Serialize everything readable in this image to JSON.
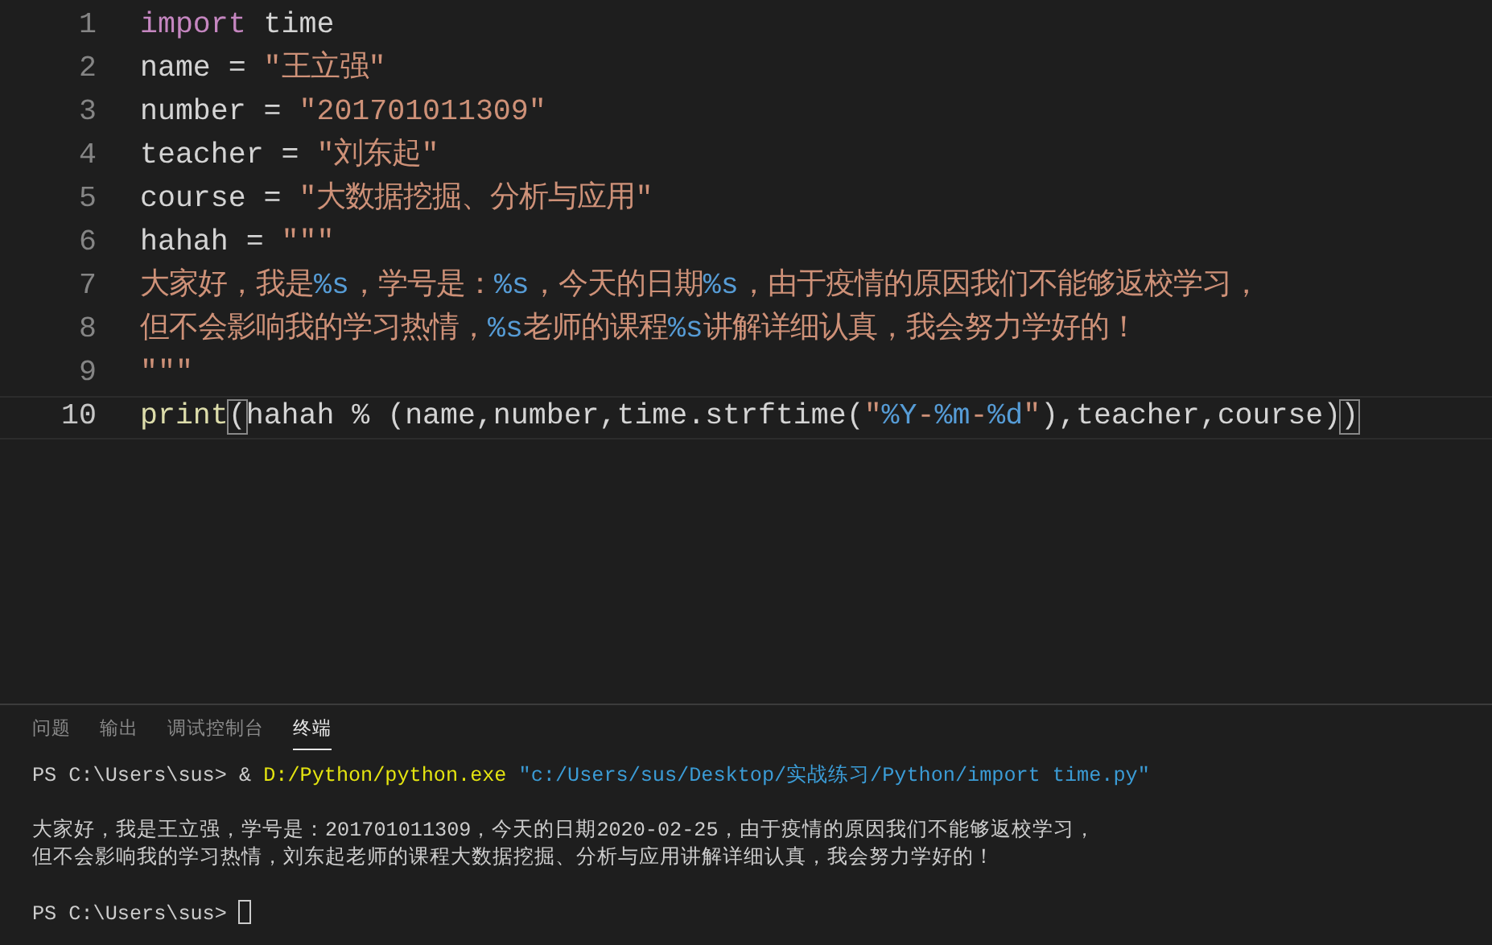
{
  "editor": {
    "lines": [
      {
        "number": "1",
        "current": false,
        "tokens": [
          {
            "kind": "keyword",
            "text": "import"
          },
          {
            "kind": "plain",
            "text": " time"
          }
        ]
      },
      {
        "number": "2",
        "current": false,
        "tokens": [
          {
            "kind": "plain",
            "text": "name = "
          },
          {
            "kind": "string",
            "text": "\"王立强\""
          }
        ]
      },
      {
        "number": "3",
        "current": false,
        "tokens": [
          {
            "kind": "plain",
            "text": "number = "
          },
          {
            "kind": "string",
            "text": "\"201701011309\""
          }
        ]
      },
      {
        "number": "4",
        "current": false,
        "tokens": [
          {
            "kind": "plain",
            "text": "teacher = "
          },
          {
            "kind": "string",
            "text": "\"刘东起\""
          }
        ]
      },
      {
        "number": "5",
        "current": false,
        "tokens": [
          {
            "kind": "plain",
            "text": "course = "
          },
          {
            "kind": "string",
            "text": "\"大数据挖掘、分析与应用\""
          }
        ]
      },
      {
        "number": "6",
        "current": false,
        "tokens": [
          {
            "kind": "plain",
            "text": "hahah = "
          },
          {
            "kind": "string",
            "text": "\"\"\""
          }
        ]
      },
      {
        "number": "7",
        "current": false,
        "tokens": [
          {
            "kind": "string",
            "text": "大家好，我是"
          },
          {
            "kind": "format",
            "text": "%s"
          },
          {
            "kind": "string",
            "text": "，学号是："
          },
          {
            "kind": "format",
            "text": "%s"
          },
          {
            "kind": "string",
            "text": "，今天的日期"
          },
          {
            "kind": "format",
            "text": "%s"
          },
          {
            "kind": "string",
            "text": "，由于疫情的原因我们不能够返校学习，"
          }
        ]
      },
      {
        "number": "8",
        "current": false,
        "tokens": [
          {
            "kind": "string",
            "text": "但不会影响我的学习热情，"
          },
          {
            "kind": "format",
            "text": "%s"
          },
          {
            "kind": "string",
            "text": "老师的课程"
          },
          {
            "kind": "format",
            "text": "%s"
          },
          {
            "kind": "string",
            "text": "讲解详细认真，我会努力学好的！"
          }
        ]
      },
      {
        "number": "9",
        "current": false,
        "tokens": [
          {
            "kind": "string",
            "text": "\"\"\""
          }
        ]
      },
      {
        "number": "10",
        "current": true,
        "tokens": [
          {
            "kind": "function",
            "text": "print"
          },
          {
            "kind": "bracket-match",
            "text": "("
          },
          {
            "kind": "plain",
            "text": "hahah % (name,number,time.strftime("
          },
          {
            "kind": "string",
            "text": "\""
          },
          {
            "kind": "format",
            "text": "%Y"
          },
          {
            "kind": "string",
            "text": "-"
          },
          {
            "kind": "format",
            "text": "%m"
          },
          {
            "kind": "string",
            "text": "-"
          },
          {
            "kind": "format",
            "text": "%d"
          },
          {
            "kind": "string",
            "text": "\""
          },
          {
            "kind": "plain",
            "text": "),teacher,course)"
          },
          {
            "kind": "bracket-match",
            "text": ")"
          }
        ]
      }
    ]
  },
  "panel": {
    "tabs": [
      {
        "label": "问题",
        "selected": false
      },
      {
        "label": "输出",
        "selected": false
      },
      {
        "label": "调试控制台",
        "selected": false
      },
      {
        "label": "终端",
        "selected": true
      }
    ],
    "terminal": [
      {
        "lines": [
          {
            "segments": [
              {
                "kind": "prompt",
                "text": "PS C:\\Users\\sus> & "
              },
              {
                "kind": "command",
                "text": "D:/Python/python.exe"
              },
              {
                "kind": "argument",
                "text": "\"c:/Users/sus/Desktop/实战练习/Python/import time.py\""
              }
            ]
          }
        ]
      },
      {
        "lines": [
          {
            "segments": [
              {
                "kind": "output",
                "text": "大家好，我是王立强，学号是：201701011309，今天的日期2020-02-25，由于疫情的原因我们不能够返校学习，"
              }
            ]
          },
          {
            "segments": [
              {
                "kind": "output",
                "text": "但不会影响我的学习热情，刘东起老师的课程大数据挖掘、分析与应用讲解详细认真，我会努力学好的！"
              }
            ]
          }
        ]
      },
      {
        "lines": [
          {
            "segments": [
              {
                "kind": "prompt",
                "text": "PS C:\\Users\\sus>"
              }
            ],
            "cursor": true
          }
        ]
      }
    ]
  }
}
